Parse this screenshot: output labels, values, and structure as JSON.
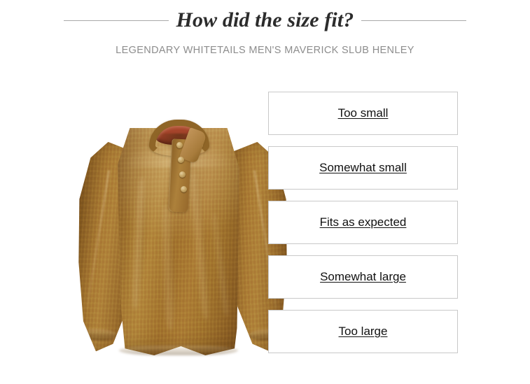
{
  "header": {
    "title": "How did the size fit?",
    "subtitle": "LEGENDARY WHITETAILS MEN'S MAVERICK SLUB HENLEY"
  },
  "product": {
    "alt": "Legendary Whitetails Men's Maverick Slub Henley shirt in tan",
    "shirt_color": "#a5762f",
    "collar_lining_color": "#a8452f",
    "button_color": "#c8a868",
    "button_count": 4
  },
  "options": [
    {
      "label": "Too small"
    },
    {
      "label": "Somewhat small"
    },
    {
      "label": "Fits as expected"
    },
    {
      "label": "Somewhat large"
    },
    {
      "label": "Too large"
    }
  ],
  "colors": {
    "background": "#ffffff",
    "title": "#2c2c2c",
    "subtitle": "#8d8d8d",
    "rule": "#a9a9a9",
    "option_border": "#c9c9c9",
    "option_text": "#111111"
  }
}
